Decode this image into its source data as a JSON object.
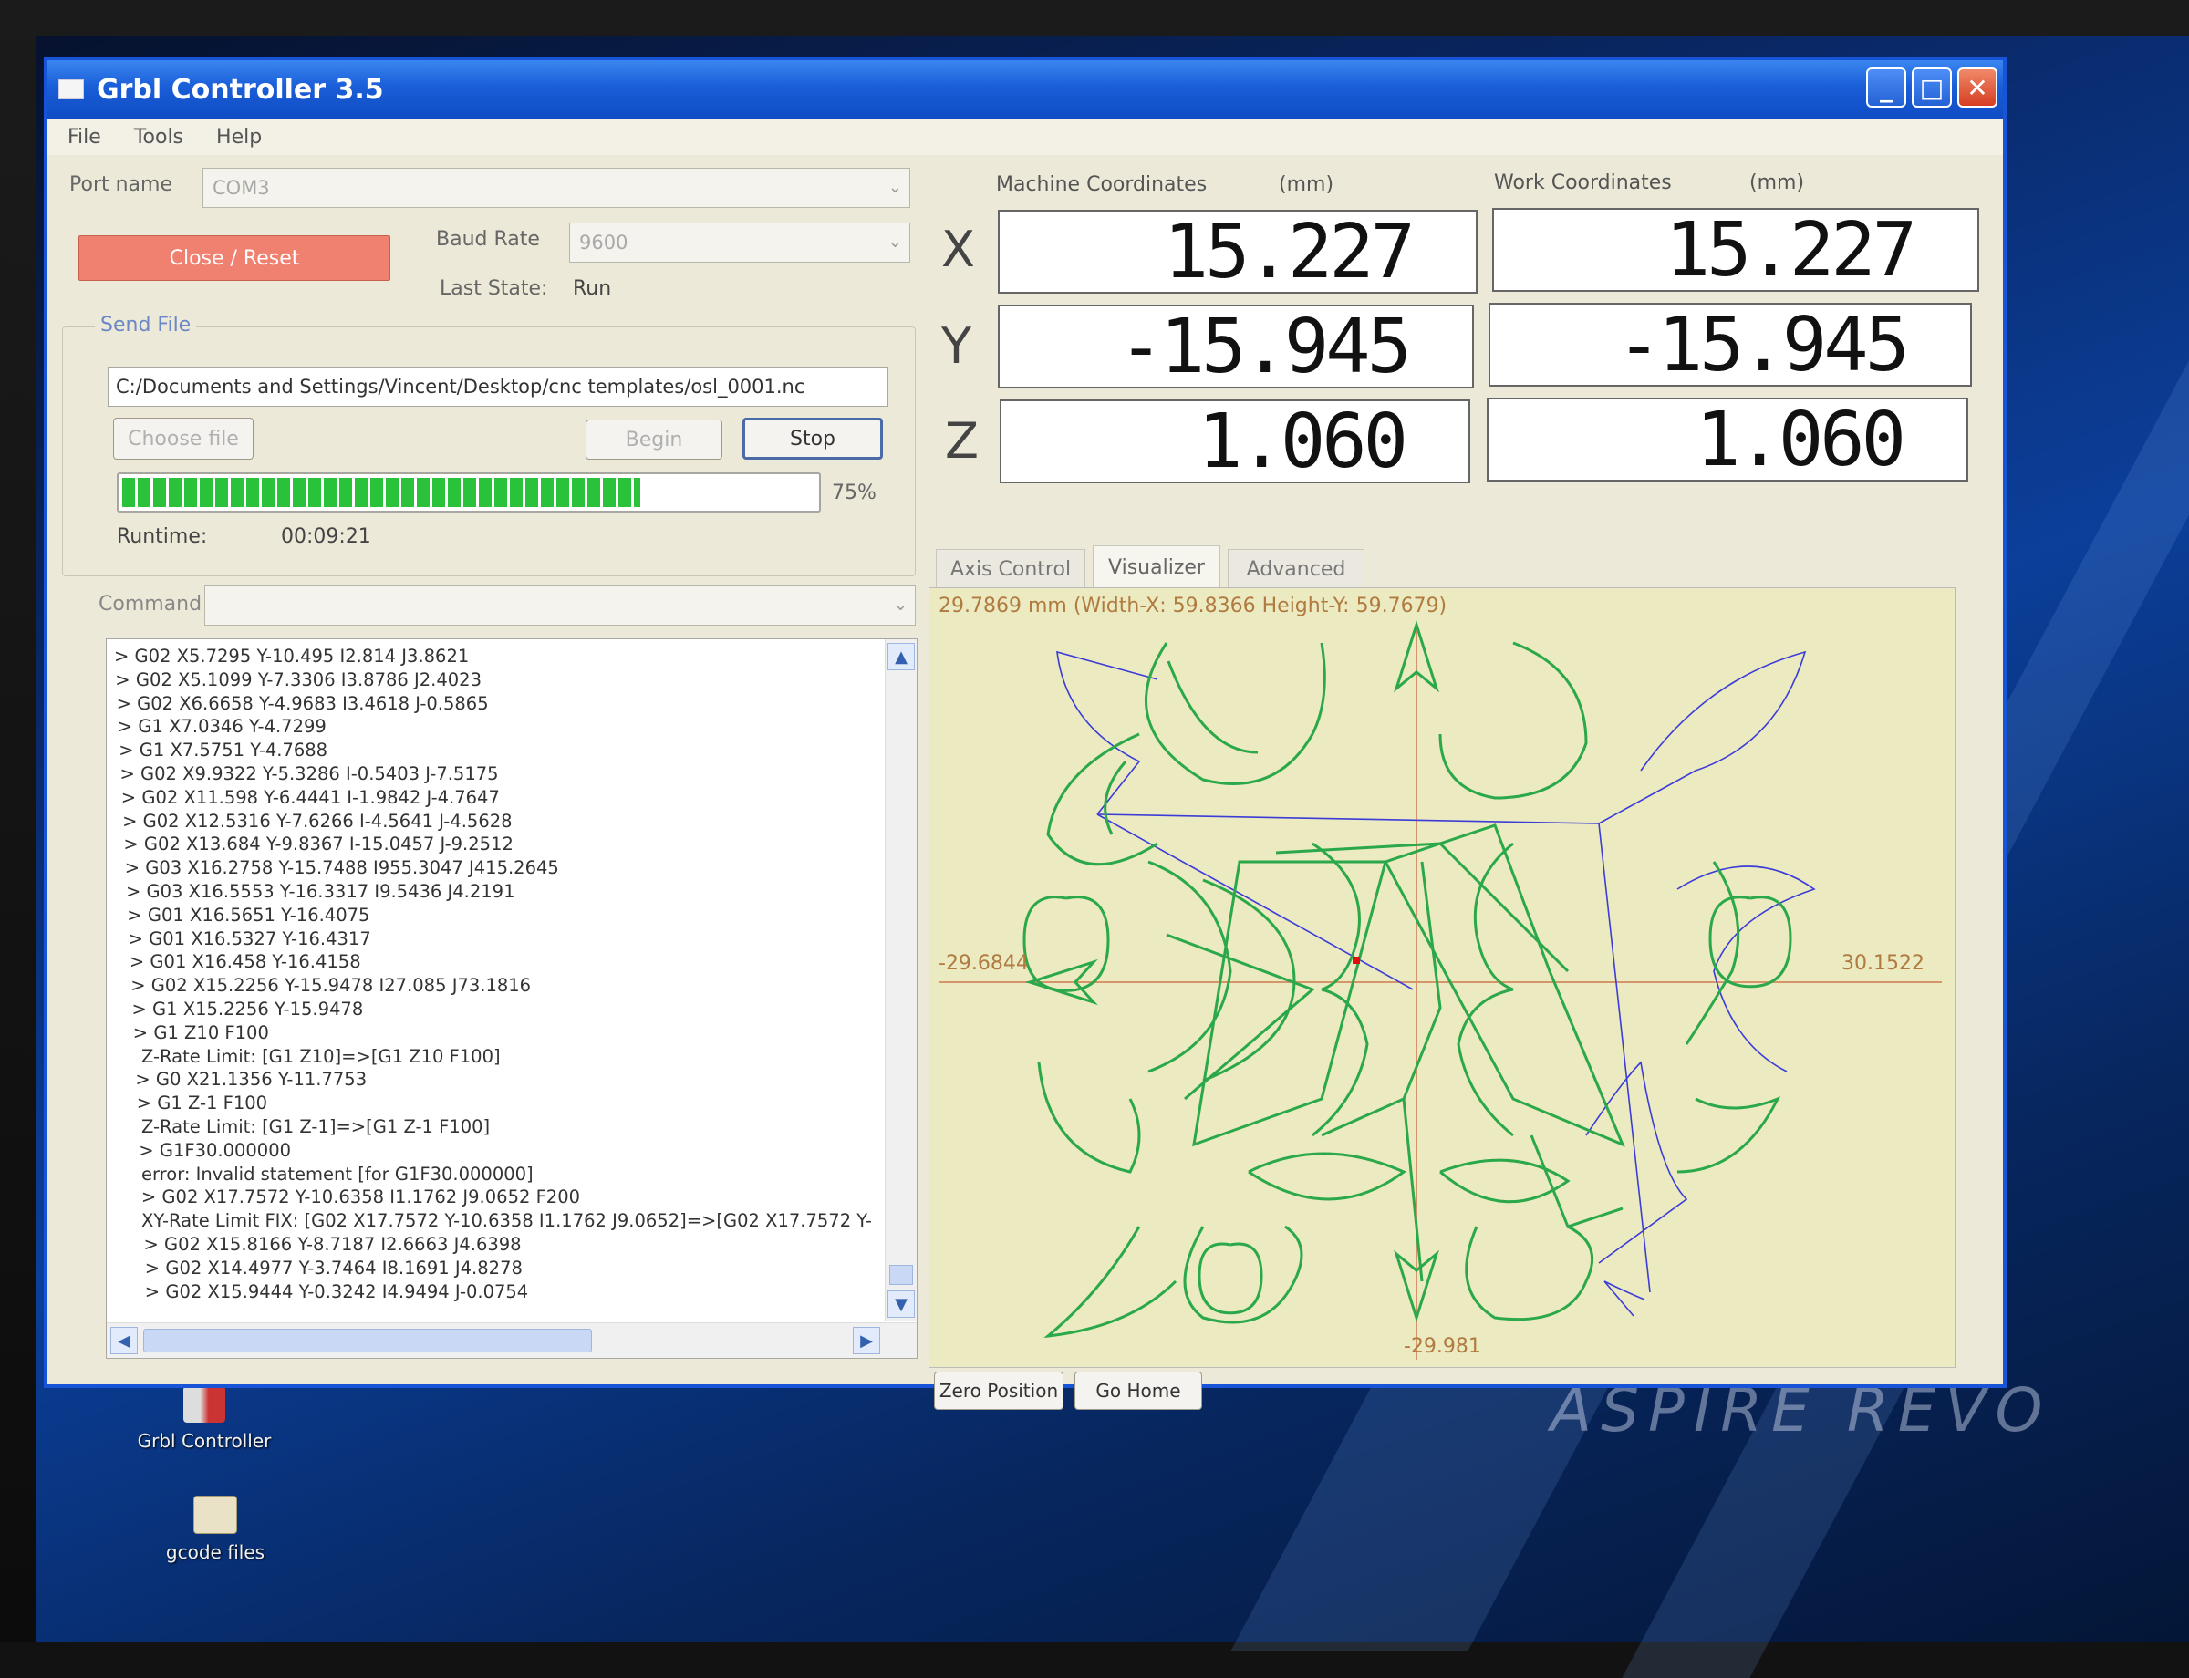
{
  "window": {
    "title": "Grbl Controller 3.5",
    "min": "_",
    "max": "□",
    "close": "✕"
  },
  "menu": [
    "File",
    "Tools",
    "Help"
  ],
  "connection": {
    "port_label": "Port name",
    "port_value": "COM3",
    "close_reset": "Close / Reset",
    "baud_label": "Baud Rate",
    "baud_value": "9600",
    "last_state_label": "Last State:",
    "last_state_value": "Run"
  },
  "send_file": {
    "group_label": "Send File",
    "path": "C:/Documents and Settings/Vincent/Desktop/cnc templates/osl_0001.nc",
    "choose_file": "Choose file",
    "begin": "Begin",
    "stop": "Stop",
    "progress_percent": 75,
    "progress_label": "75%",
    "runtime_label": "Runtime:",
    "runtime_value": "00:09:21"
  },
  "command": {
    "label": "Command",
    "value": ""
  },
  "console": [
    "> G02 X5.7295 Y-10.495 I2.814 J3.8621",
    "> G02 X5.1099 Y-7.3306 I3.8786 J2.4023",
    "> G02 X6.6658 Y-4.9683 I3.4618 J-0.5865",
    "> G1  X7.0346 Y-4.7299",
    "> G1  X7.5751 Y-4.7688",
    "> G02 X9.9322 Y-5.3286 I-0.5403 J-7.5175",
    "> G02 X11.598 Y-6.4441 I-1.9842 J-4.7647",
    "> G02 X12.5316 Y-7.6266 I-4.5641 J-4.5628",
    "> G02 X13.684 Y-9.8367 I-15.0457 J-9.2512",
    "> G03 X16.2758 Y-15.7488 I955.3047 J415.2645",
    "> G03 X16.5553 Y-16.3317 I9.5436 J4.2191",
    "> G01 X16.5651 Y-16.4075",
    "> G01 X16.5327 Y-16.4317",
    "> G01 X16.458 Y-16.4158",
    "> G02 X15.2256 Y-15.9478 I27.085 J73.1816",
    "> G1  X15.2256 Y-15.9478",
    "> G1 Z10 F100",
    "Z-Rate Limit: [G1 Z10]=>[G1 Z10 F100]",
    "> G0 X21.1356 Y-11.7753",
    "> G1 Z-1 F100",
    "Z-Rate Limit: [G1 Z-1]=>[G1 Z-1 F100]",
    "> G1F30.000000",
    "error: Invalid statement [for G1F30.000000]",
    "> G02 X17.7572 Y-10.6358 I1.1762 J9.0652 F200",
    "XY-Rate Limit FIX: [G02 X17.7572 Y-10.6358 I1.1762 J9.0652]=>[G02 X17.7572 Y-",
    "> G02 X15.8166 Y-8.7187 I2.6663 J4.6398",
    "> G02 X14.4977 Y-3.7464 I8.1691 J4.8278",
    "> G02 X15.9444 Y-0.3242 I4.9494 J-0.0754"
  ],
  "coords": {
    "machine_label": "Machine Coordinates",
    "work_label": "Work Coordinates",
    "unit": "(mm)",
    "axes": [
      "X",
      "Y",
      "Z"
    ],
    "machine": [
      "15.227",
      "-15.945",
      "1.060"
    ],
    "work": [
      "15.227",
      "-15.945",
      "1.060"
    ]
  },
  "tabs": [
    "Axis Control",
    "Visualizer",
    "Advanced"
  ],
  "active_tab": "Visualizer",
  "visualizer": {
    "header": "29.7869 mm  (Width-X: 59.8366  Height-Y: 59.7679)",
    "x_min_label": "-29.6844",
    "x_max_label": "30.1522",
    "y_min_label": "-29.981",
    "toolpath_color": "#2aa84a",
    "rapid_color": "#3c3cd8",
    "axis_color": "#d6946a",
    "tool_color": "#e01010"
  },
  "bottom_buttons": {
    "zero_position": "Zero Position",
    "go_home": "Go Home"
  },
  "desktop": {
    "brand": "ASPIRE REVO",
    "icons": [
      "Grbl Controller",
      "gcode files"
    ]
  }
}
